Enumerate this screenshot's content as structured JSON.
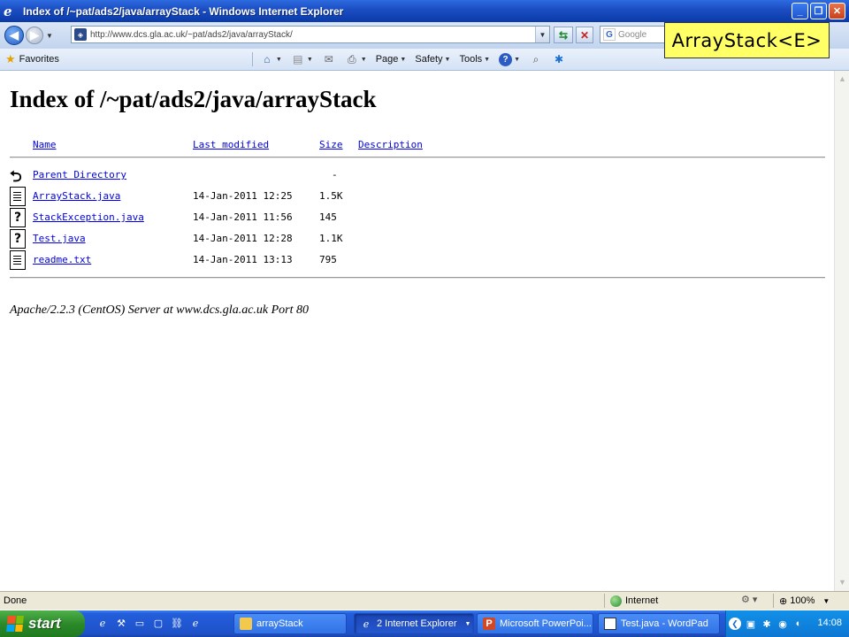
{
  "window": {
    "title": "Index of /~pat/ads2/java/arrayStack - Windows Internet Explorer",
    "controls": [
      "minimize",
      "maximize",
      "close"
    ]
  },
  "address_bar": {
    "url": "http://www.dcs.gla.ac.uk/~pat/ads2/java/arrayStack/",
    "search_placeholder": "Google"
  },
  "overlay": {
    "label": "ArrayStack<E>"
  },
  "command_bar": {
    "favorites": "Favorites",
    "page": "Page",
    "safety": "Safety",
    "tools": "Tools"
  },
  "page": {
    "heading": "Index of /~pat/ads2/java/arrayStack",
    "columns": {
      "name": "Name",
      "last_modified": "Last modified",
      "size": "Size",
      "description": "Description"
    },
    "entries": [
      {
        "icon": "back-icon",
        "name": "Parent Directory",
        "date": "",
        "size": "-"
      },
      {
        "icon": "text-file-icon",
        "name": "ArrayStack.java",
        "date": "14-Jan-2011 12:25",
        "size": "1.5K"
      },
      {
        "icon": "unknown-file-icon",
        "name": "StackException.java",
        "date": "14-Jan-2011 11:56",
        "size": "145"
      },
      {
        "icon": "unknown-file-icon",
        "name": "Test.java",
        "date": "14-Jan-2011 12:28",
        "size": "1.1K"
      },
      {
        "icon": "text-file-icon",
        "name": "readme.txt",
        "date": "14-Jan-2011 13:13",
        "size": "795"
      }
    ],
    "server_signature": "Apache/2.2.3 (CentOS) Server at www.dcs.gla.ac.uk Port 80"
  },
  "status_bar": {
    "status": "Done",
    "zone": "Internet",
    "zoom": "100%"
  },
  "taskbar": {
    "start": "start",
    "buttons": [
      {
        "label": "arrayStack",
        "icon": "folder-icon"
      },
      {
        "label": "2 Internet Explorer",
        "icon": "ie-icon"
      },
      {
        "label": "Microsoft PowerPoi...",
        "icon": "powerpoint-icon"
      },
      {
        "label": "Test.java - WordPad",
        "icon": "wordpad-icon"
      }
    ],
    "clock": "14:08"
  }
}
